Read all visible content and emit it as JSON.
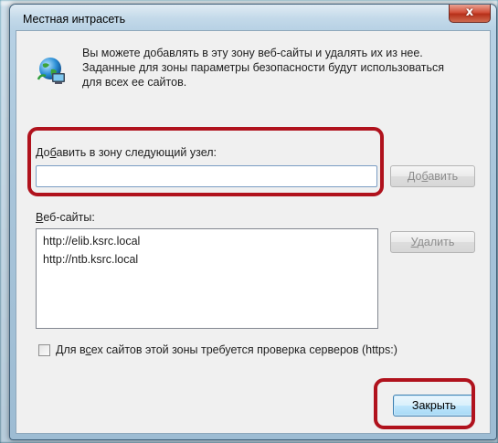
{
  "window": {
    "title": "Местная интрасеть",
    "close_glyph": "x"
  },
  "info": {
    "text": "Вы можете добавлять в эту зону  веб-сайты и удалять их из нее. Заданные для зоны параметры безопасности будут использоваться для всех ее сайтов.",
    "icon": "globe-computer-icon"
  },
  "add_zone": {
    "label_prefix": "До",
    "label_accel": "б",
    "label_suffix": "авить в зону следующий узел:",
    "input_value": "",
    "add_button_prefix": "До",
    "add_button_accel": "б",
    "add_button_suffix": "авить"
  },
  "sites": {
    "label_accel": "В",
    "label_suffix": "еб-сайты:",
    "items": [
      "http://elib.ksrc.local",
      "http://ntb.ksrc.local"
    ],
    "remove_button_accel": "У",
    "remove_button_suffix": "далить"
  },
  "https": {
    "checked": false,
    "label_prefix": "Для в",
    "label_accel": "с",
    "label_suffix": "ех сайтов этой зоны требуется проверка серверов (https:)"
  },
  "footer": {
    "close_button": "Закрыть"
  },
  "colors": {
    "highlight": "#b0121d",
    "close_button_red": "#c2442d",
    "default_button_border": "#3c7fb1"
  }
}
